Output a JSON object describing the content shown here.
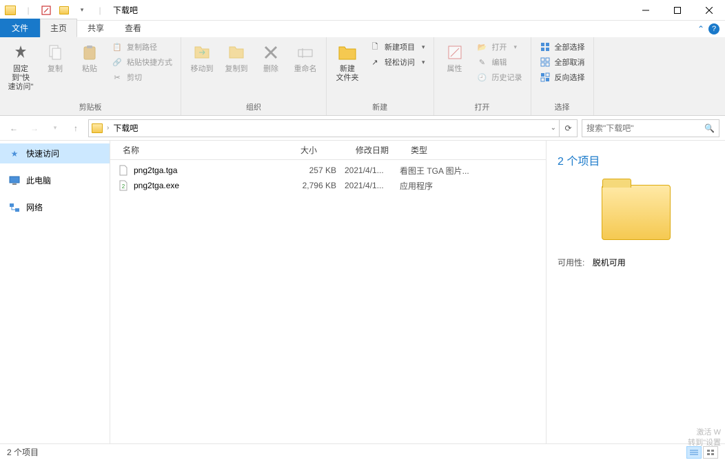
{
  "window": {
    "title": "下载吧"
  },
  "tabs": {
    "file": "文件",
    "home": "主页",
    "share": "共享",
    "view": "查看"
  },
  "ribbon": {
    "clipboard": {
      "label": "剪贴板",
      "pin": "固定到\"快\n速访问\"",
      "copy": "复制",
      "paste": "粘贴",
      "copypath": "复制路径",
      "pasteshortcut": "粘贴快捷方式",
      "cut": "剪切"
    },
    "organize": {
      "label": "组织",
      "moveto": "移动到",
      "copyto": "复制到",
      "delete": "删除",
      "rename": "重命名"
    },
    "new": {
      "label": "新建",
      "newfolder": "新建\n文件夹",
      "newitem": "新建项目",
      "easyaccess": "轻松访问"
    },
    "open": {
      "label": "打开",
      "properties": "属性",
      "open": "打开",
      "edit": "编辑",
      "history": "历史记录"
    },
    "select": {
      "label": "选择",
      "selectall": "全部选择",
      "selectnone": "全部取消",
      "invert": "反向选择"
    }
  },
  "address": {
    "crumb": "下载吧",
    "refresh_tip": "刷新"
  },
  "search": {
    "placeholder": "搜索\"下载吧\""
  },
  "sidebar": {
    "items": [
      {
        "label": "快速访问"
      },
      {
        "label": "此电脑"
      },
      {
        "label": "网络"
      }
    ]
  },
  "columns": {
    "name": "名称",
    "size": "大小",
    "date": "修改日期",
    "type": "类型"
  },
  "files": [
    {
      "name": "png2tga.tga",
      "size": "257 KB",
      "date": "2021/4/1...",
      "type": "看图王 TGA 图片..."
    },
    {
      "name": "png2tga.exe",
      "size": "2,796 KB",
      "date": "2021/4/1...",
      "type": "应用程序"
    }
  ],
  "preview": {
    "count": "2 个项目",
    "availability_label": "可用性:",
    "availability_value": "脱机可用"
  },
  "status": {
    "text": "2 个项目"
  },
  "watermark": {
    "line1": "激活 W",
    "line2": "转到\"设置"
  }
}
